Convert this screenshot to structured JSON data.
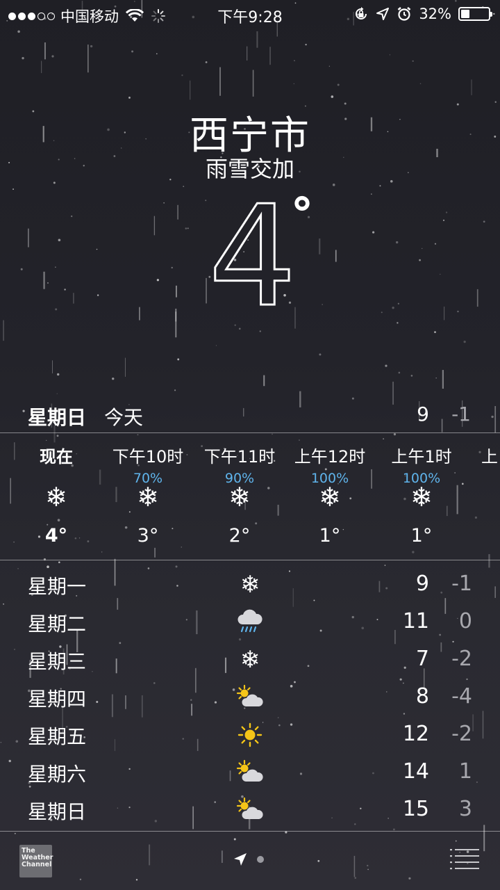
{
  "status_bar": {
    "signal_dots": [
      true,
      true,
      true,
      false,
      false
    ],
    "carrier": "中国移动",
    "time": "下午9:28",
    "battery_percent": "32%",
    "battery_level": 0.32
  },
  "header": {
    "city": "西宁市",
    "condition": "雨雪交加",
    "temperature": "4",
    "degree": "°"
  },
  "today": {
    "day": "星期日",
    "label": "今天",
    "high": "9",
    "low": "-1"
  },
  "hourly": [
    {
      "time": "现在",
      "precip": "",
      "icon": "snow-icon",
      "temp": "4°"
    },
    {
      "time": "下午10时",
      "precip": "70%",
      "icon": "snow-icon",
      "temp": "3°"
    },
    {
      "time": "下午11时",
      "precip": "90%",
      "icon": "snow-icon",
      "temp": "2°"
    },
    {
      "time": "上午12时",
      "precip": "100%",
      "icon": "snow-icon",
      "temp": "1°"
    },
    {
      "time": "上午1时",
      "precip": "100%",
      "icon": "snow-icon",
      "temp": "1°"
    },
    {
      "time": "上",
      "precip": "",
      "icon": "",
      "temp": ""
    }
  ],
  "daily": [
    {
      "day": "星期一",
      "icon": "snow-icon",
      "high": "9",
      "low": "-1"
    },
    {
      "day": "星期二",
      "icon": "rain-cloud-icon",
      "high": "11",
      "low": "0"
    },
    {
      "day": "星期三",
      "icon": "snow-icon",
      "high": "7",
      "low": "-2"
    },
    {
      "day": "星期四",
      "icon": "partly-sunny-icon",
      "high": "8",
      "low": "-4"
    },
    {
      "day": "星期五",
      "icon": "sun-icon",
      "high": "12",
      "low": "-2"
    },
    {
      "day": "星期六",
      "icon": "partly-sunny-icon",
      "high": "14",
      "low": "1"
    },
    {
      "day": "星期日",
      "icon": "partly-sunny-icon",
      "high": "15",
      "low": "3"
    }
  ],
  "footer": {
    "logo_lines": [
      "The",
      "Weather",
      "Channel"
    ],
    "icons": [
      "location-arrow-icon",
      "page-dot-icon",
      "list-icon"
    ]
  },
  "colors": {
    "precip": "#5fb4ec",
    "sun": "#f5c518",
    "low_temp": "#a8a8ae"
  }
}
